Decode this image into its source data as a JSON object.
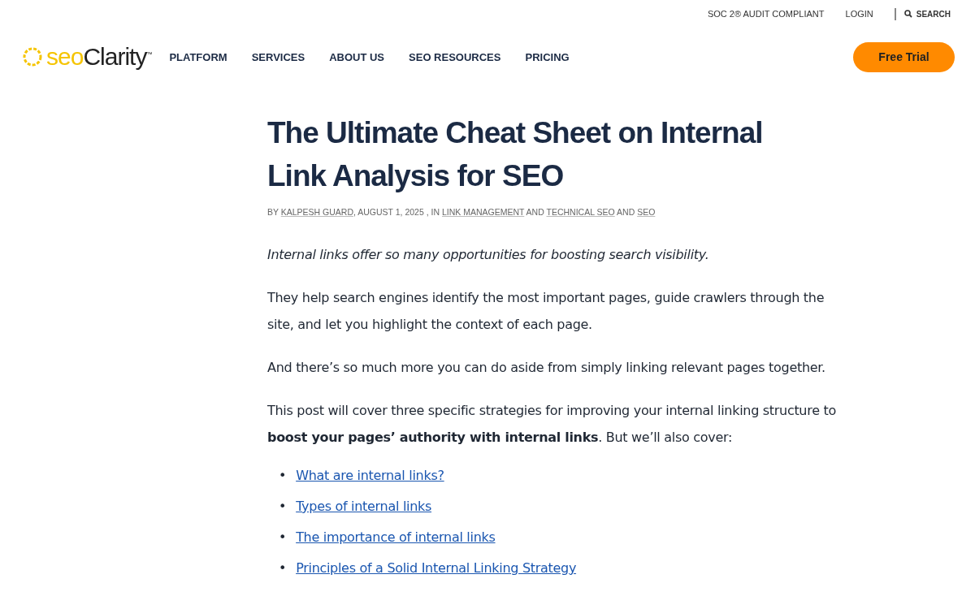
{
  "top_bar": {
    "links": [
      "SOC 2® AUDIT COMPLIANT",
      "LOGIN"
    ],
    "search": "SEARCH"
  },
  "logo": {
    "prefix": "seo",
    "name": "Clarity",
    "mark": "™"
  },
  "nav": [
    "PLATFORM",
    "SERVICES",
    "ABOUT US",
    "SEO RESOURCES",
    "PRICING"
  ],
  "cta": "Free Trial",
  "article": {
    "title_lines": [
      "The Ultimate Cheat Sheet on Internal",
      "Link Analysis for SEO"
    ],
    "meta": [
      {
        "kind": "text",
        "text": "BY "
      },
      {
        "kind": "link",
        "text": "KALPESH GUARD"
      },
      {
        "kind": "text",
        "text": ", AUGUST 1, 2025 , IN "
      },
      {
        "kind": "link",
        "text": "LINK MANAGEMENT"
      },
      {
        "kind": "text",
        "text": " AND "
      },
      {
        "kind": "link",
        "text": "TECHNICAL SEO"
      },
      {
        "kind": "text",
        "text": " AND "
      },
      {
        "kind": "link",
        "text": "SEO"
      }
    ],
    "paragraphs": [
      {
        "kind": "lead",
        "text": "Internal links offer so many opportunities for boosting search visibility."
      },
      {
        "kind": "body",
        "text": "They help search engines identify the most important pages, guide crawlers through the site, and let you highlight the context of each page."
      },
      {
        "kind": "body",
        "text": "And there’s so much more you can do aside from simply linking relevant pages together."
      },
      {
        "kind": "body",
        "text": "This post will cover three specific strategies for improving your internal linking structure to **boost your pages’ authority with internal links**. But we’ll also cover:"
      }
    ],
    "toc": [
      {
        "marker": "•",
        "text": "What are internal links?"
      },
      {
        "marker": "•",
        "text": "Types of internal links"
      },
      {
        "marker": "•",
        "text": "The importance of internal links"
      },
      {
        "marker": "•",
        "text": "Principles of a Solid Internal Linking Strategy"
      }
    ]
  }
}
